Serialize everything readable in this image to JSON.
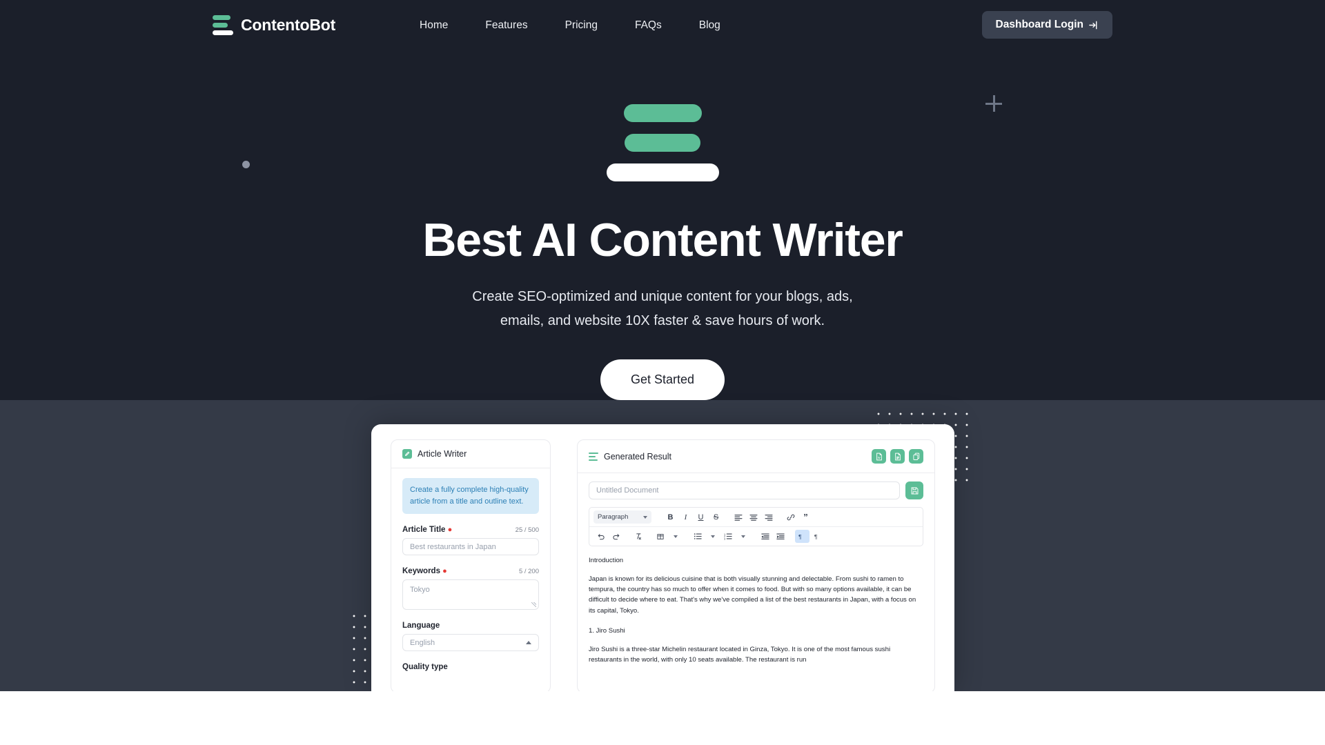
{
  "nav": {
    "brand": "ContentoBot",
    "links": [
      {
        "label": "Home"
      },
      {
        "label": "Features"
      },
      {
        "label": "Pricing"
      },
      {
        "label": "FAQs"
      },
      {
        "label": "Blog"
      }
    ],
    "login_label": "Dashboard Login"
  },
  "hero": {
    "heading": "Best AI Content Writer",
    "subheading_line1": "Create SEO-optimized and unique content for your blogs, ads,",
    "subheading_line2": "emails, and website 10X faster & save hours of work.",
    "cta_label": "Get Started"
  },
  "colors": {
    "background": "#1b1f2a",
    "background_lower": "#343a47",
    "accent_green": "#5cbd96",
    "button_dark": "#3a4150",
    "notice_bg": "#d7ebf8",
    "notice_text": "#2b7fb5",
    "required_red": "#e53935",
    "toolbar_active": "#cfe3fb"
  },
  "app_mock": {
    "left_panel": {
      "title": "Article Writer",
      "icon": "pencil-icon",
      "notice": "Create a fully complete high-quality article from a title and outline text.",
      "fields": [
        {
          "label": "Article Title",
          "required": true,
          "counter": "25 / 500",
          "value": "Best restaurants in Japan",
          "type": "input"
        },
        {
          "label": "Keywords",
          "required": true,
          "counter": "5 / 200",
          "value": "Tokyo",
          "type": "textarea"
        },
        {
          "label": "Language",
          "required": false,
          "counter": "",
          "value": "English",
          "type": "select"
        },
        {
          "label": "Quality type",
          "required": false,
          "counter": "",
          "value": "",
          "type": "label"
        }
      ]
    },
    "right_panel": {
      "title": "Generated Result",
      "icon": "lines-icon",
      "header_actions": [
        {
          "name": "export-word-icon"
        },
        {
          "name": "export-file-icon"
        },
        {
          "name": "copy-icon"
        }
      ],
      "document_name_placeholder": "Untitled Document",
      "save_icon": "save-icon",
      "toolbar": {
        "block_format": "Paragraph",
        "row1": [
          {
            "name": "bold-icon",
            "glyph": "B"
          },
          {
            "name": "italic-icon",
            "glyph": "I"
          },
          {
            "name": "underline-icon",
            "glyph": "U"
          },
          {
            "name": "strikethrough-icon",
            "glyph": "S"
          },
          {
            "name": "align-left-icon",
            "glyph": ""
          },
          {
            "name": "align-center-icon",
            "glyph": ""
          },
          {
            "name": "align-right-icon",
            "glyph": ""
          },
          {
            "name": "link-icon",
            "glyph": ""
          },
          {
            "name": "blockquote-icon",
            "glyph": "”"
          }
        ],
        "row2": [
          {
            "name": "undo-icon"
          },
          {
            "name": "redo-icon"
          },
          {
            "name": "clear-format-icon"
          },
          {
            "name": "table-icon"
          },
          {
            "name": "bullet-list-icon"
          },
          {
            "name": "numbered-list-icon"
          },
          {
            "name": "outdent-icon"
          },
          {
            "name": "indent-icon"
          },
          {
            "name": "ltr-direction-icon"
          },
          {
            "name": "rtl-direction-icon"
          }
        ]
      },
      "document": {
        "h1": "Introduction",
        "p1": "Japan is known for its delicious cuisine that is both visually stunning and delectable. From sushi to ramen to tempura, the country has so much to offer when it comes to food. But with so many options available, it can be difficult to decide where to eat. That's why we've compiled a list of the best restaurants in Japan, with a focus on its capital, Tokyo.",
        "h2": "1. Jiro Sushi",
        "p2": "Jiro Sushi is a three-star Michelin restaurant located in Ginza, Tokyo. It is one of the most famous sushi restaurants in the world, with only 10 seats available. The restaurant is run"
      }
    }
  }
}
